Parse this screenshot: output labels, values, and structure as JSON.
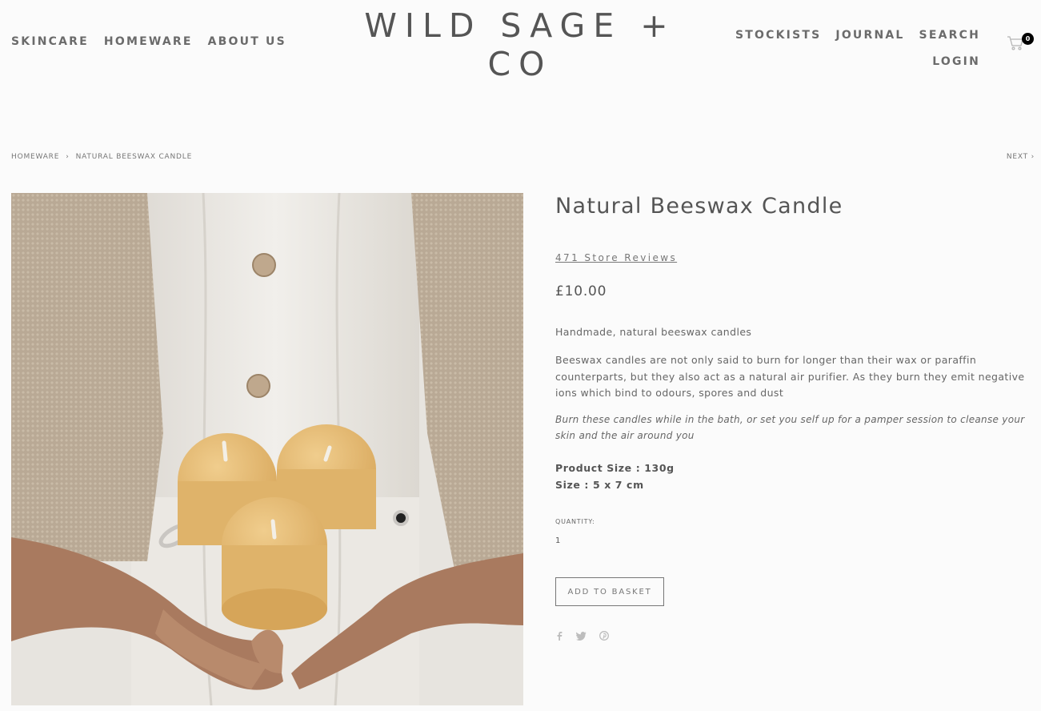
{
  "header": {
    "nav_left": [
      "SKINCARE",
      "HOMEWARE",
      "ABOUT US"
    ],
    "logo_line1": "WILD SAGE +",
    "logo_line2": "CO",
    "nav_right": [
      "STOCKISTS",
      "JOURNAL",
      "SEARCH"
    ],
    "login": "LOGIN",
    "cart_count": "0",
    "cart_icon": "shopping-cart-icon"
  },
  "breadcrumb": {
    "items": [
      "HOMEWARE",
      "NATURAL BEESWAX CANDLE"
    ],
    "separator": "›",
    "next": "NEXT ›"
  },
  "product": {
    "title": "Natural Beeswax Candle",
    "reviews": "471 Store Reviews",
    "price": "£10.00",
    "description_short": "Handmade, natural beeswax candles",
    "description_long": "Beeswax candles are not only said to burn for longer than their wax or paraffin counterparts, but they also act as a natural air purifier. As they burn they emit negative ions which bind to odours, spores and dust",
    "description_italic": "Burn these candles while in the bath, or set you self up for a pamper session to cleanse your skin and the air around you",
    "spec_size_weight": "Product Size : 130g",
    "spec_dimensions": "Size : 5 x 7 cm",
    "quantity_label": "QUANTITY:",
    "quantity_value": "1",
    "add_to_basket": "ADD TO BASKET",
    "share_icons": [
      "facebook-icon",
      "twitter-icon",
      "pinterest-icon"
    ]
  },
  "colors": {
    "background": "#fbfbfb",
    "text": "#555555",
    "candle": "#e8be7a"
  }
}
